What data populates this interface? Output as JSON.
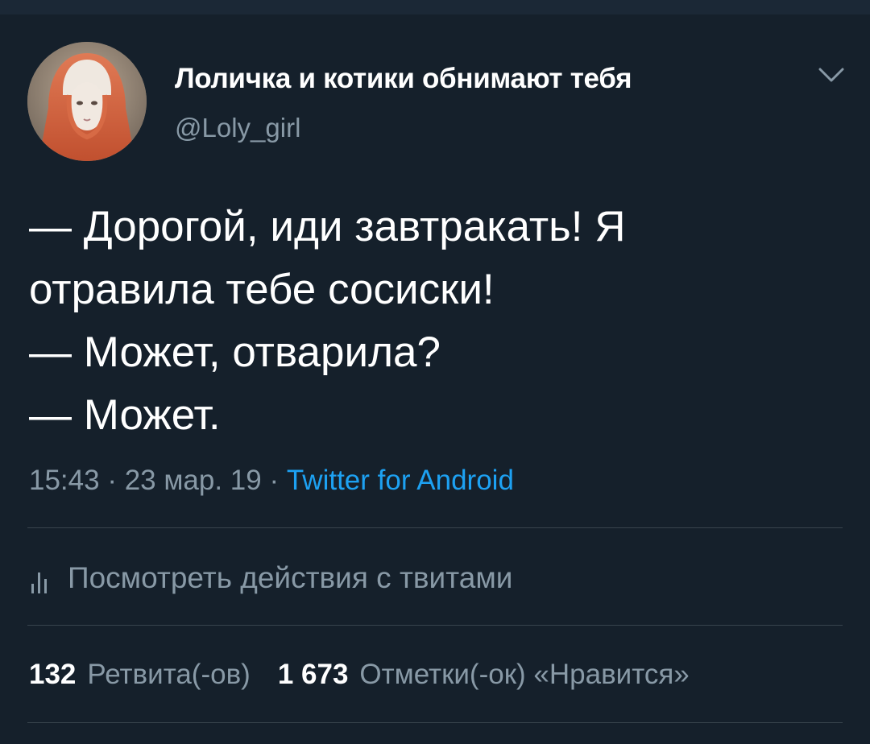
{
  "colors": {
    "background": "#15202b",
    "primary_text": "#ffffff",
    "secondary_text": "#8899a6",
    "link": "#1da1f2",
    "divider": "#38444d"
  },
  "tweet": {
    "author": {
      "display_name": "Лоличка и котики обнимают тебя",
      "handle": "@Loly_girl",
      "avatar_icon": "avatar-portrait"
    },
    "menu_icon": "chevron-down-icon",
    "text": "— Дорогой, иди завтракать! Я\nотравила тебе сосиски!\n— Может, отварила?\n— Может.",
    "time": "15:43",
    "separator": " · ",
    "date": "23 мар. 19",
    "source": "Twitter for Android"
  },
  "activity": {
    "icon": "bar-chart-icon",
    "label": "Посмотреть действия с твитами"
  },
  "stats": {
    "retweets": {
      "count": "132",
      "label": "Ретвита(-ов)"
    },
    "likes": {
      "count": "1 673",
      "label": "Отметки(-ок) «Нравится»"
    }
  }
}
